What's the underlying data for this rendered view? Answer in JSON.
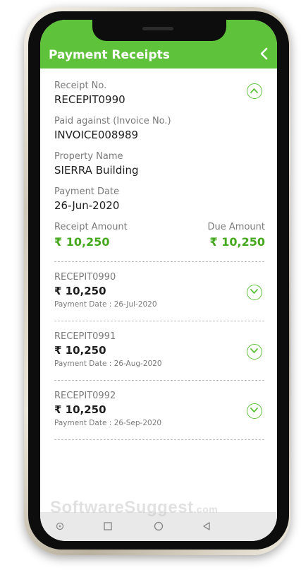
{
  "header": {
    "title": "Payment Receipts",
    "back_icon": "chevron-left-icon"
  },
  "detail": {
    "receipt_no_label": "Receipt No.",
    "receipt_no_value": "RECEPIT0990",
    "invoice_label": "Paid against (Invoice No.)",
    "invoice_value": "INVOICE008989",
    "property_label": "Property Name",
    "property_value": "SIERRA Building",
    "date_label": "Payment Date",
    "date_value": "26-Jun-2020",
    "receipt_amount_label": "Receipt Amount",
    "receipt_amount_value": "₹ 10,250",
    "due_amount_label": "Due Amount",
    "due_amount_value": "₹ 10,250",
    "collapse_icon": "chevron-up-circle-icon"
  },
  "receipts": [
    {
      "id": "RECEPIT0990",
      "amount": "₹ 10,250",
      "date": "Payment Date : 26-Jul-2020"
    },
    {
      "id": "RECEPIT0991",
      "amount": "₹ 10,250",
      "date": "Payment Date : 26-Aug-2020"
    },
    {
      "id": "RECEPIT0992",
      "amount": "₹ 10,250",
      "date": "Payment Date : 26-Sep-2020"
    }
  ],
  "watermark": {
    "text": "SoftwareSuggest",
    "suffix": ".com"
  },
  "colors": {
    "accent": "#5ec23a",
    "amount_green": "#45a81e"
  }
}
